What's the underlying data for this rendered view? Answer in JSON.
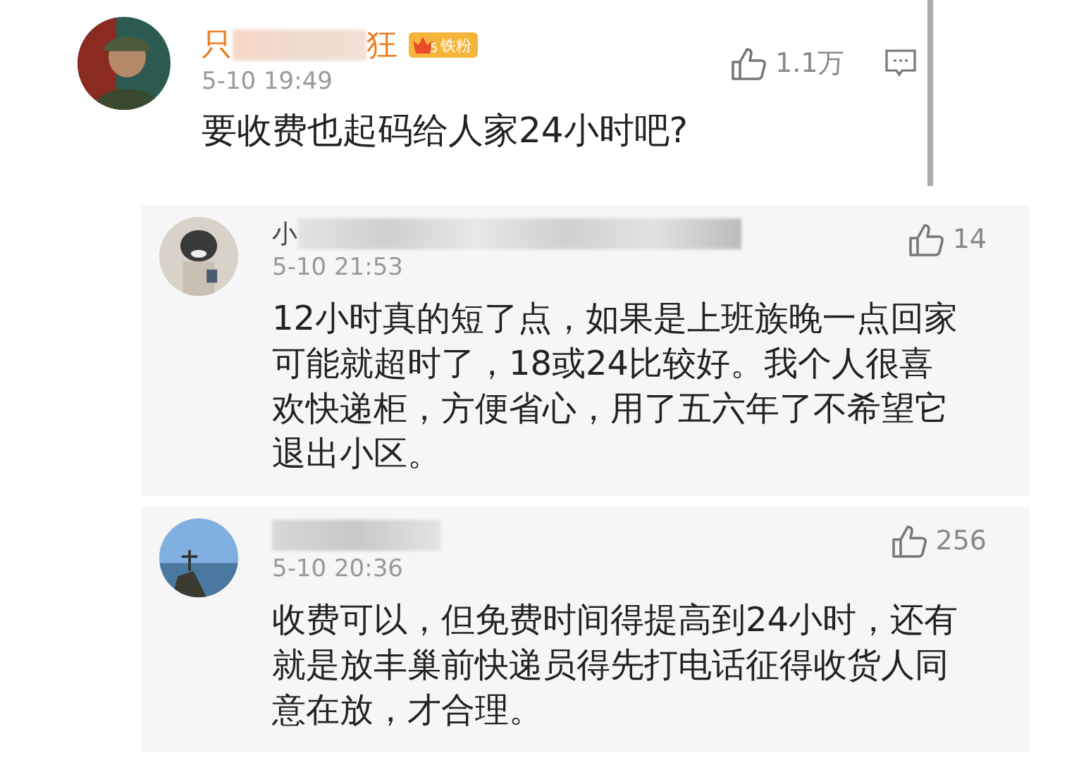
{
  "comment": {
    "name_start": "只",
    "name_end": "狂",
    "badge": {
      "level": "5",
      "label": "铁粉"
    },
    "time": "5-10 19:49",
    "text": "要收费也起码给人家24小时吧?",
    "likes": "1.1万"
  },
  "replies": [
    {
      "name_start": "小",
      "time": "5-10 21:53",
      "lines": [
        "12小时真的短了点，如果是上班族晚一点回家",
        "可能就超时了，18或24比较好。我个人很喜",
        "欢快递柜，方便省心，用了五六年了不希望它",
        "退出小区。"
      ],
      "likes": "14"
    },
    {
      "time": "5-10 20:36",
      "lines": [
        "收费可以，但免费时间得提高到24小时，还有",
        "就是放丰巢前快递员得先打电话征得收货人同",
        "意在放，才合理。"
      ],
      "likes": "256"
    }
  ]
}
